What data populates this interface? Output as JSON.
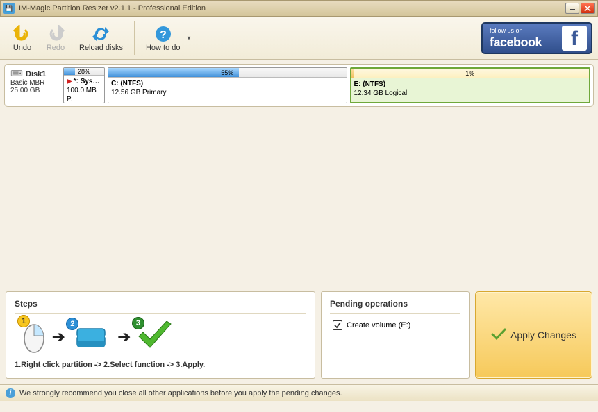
{
  "window": {
    "title": "IM-Magic Partition Resizer v2.1.1 - Professional Edition"
  },
  "toolbar": {
    "undo": "Undo",
    "redo": "Redo",
    "reload": "Reload disks",
    "howto": "How to do"
  },
  "facebook": {
    "small": "follow us on",
    "big": "facebook"
  },
  "disk": {
    "name": "Disk1",
    "type": "Basic MBR",
    "size": "25.00 GB",
    "partitions": [
      {
        "percent": "28%",
        "fillw": "28%",
        "label": "*: Sys…",
        "sub": "100.0 MB P.",
        "flag": true
      },
      {
        "percent": "55%",
        "fillw": "55%",
        "label": "C: (NTFS)",
        "sub": "12.56 GB Primary"
      },
      {
        "percent": "1%",
        "fillw": "1%",
        "label": "E: (NTFS)",
        "sub": "12.34 GB Logical"
      }
    ]
  },
  "steps": {
    "header": "Steps",
    "desc": "1.Right click partition -> 2.Select function -> 3.Apply."
  },
  "pending": {
    "header": "Pending operations",
    "item": "Create volume (E:)"
  },
  "apply": {
    "label": "Apply Changes"
  },
  "status": {
    "text": "We strongly recommend you close all other applications before you apply the pending changes."
  }
}
